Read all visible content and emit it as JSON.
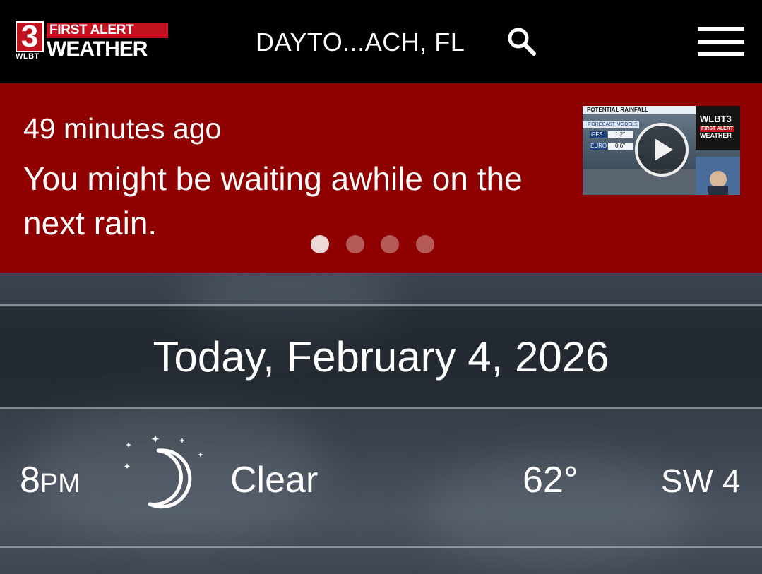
{
  "header": {
    "logo": {
      "channel_number": "3",
      "call_letters": "WLBT",
      "banner_text": "FIRST ALERT",
      "weather_text": "WEATHER"
    },
    "location": "DAYTO...ACH, FL",
    "icons": {
      "search": "search-icon",
      "menu": "hamburger-menu-icon"
    }
  },
  "alert": {
    "time_ago": "49 minutes ago",
    "headline": "You might be waiting awhile on the next rain.",
    "video": {
      "graphic_title": "POTENTIAL RAINFALL",
      "graphic_subtitle": "FORECAST MODELS",
      "rows": [
        {
          "label": "GFS",
          "value": "1.2\""
        },
        {
          "label": "EURO",
          "value": "0.6\""
        }
      ],
      "station_logo_top": "WLBT3",
      "station_logo_mid": "FIRST ALERT",
      "station_logo_bottom": "WEATHER"
    },
    "carousel": {
      "count": 4,
      "active_index": 0
    },
    "colors": {
      "background": "#8f0000"
    }
  },
  "forecast": {
    "date_heading": "Today, February 4, 2026",
    "hours": [
      {
        "hour": "8",
        "ampm": "PM",
        "icon": "moon-stars-icon",
        "condition": "Clear",
        "temperature": "62°",
        "wind": "SW 4"
      }
    ]
  },
  "colors": {
    "header_bg": "#000000",
    "brand_red": "#c1121f"
  }
}
